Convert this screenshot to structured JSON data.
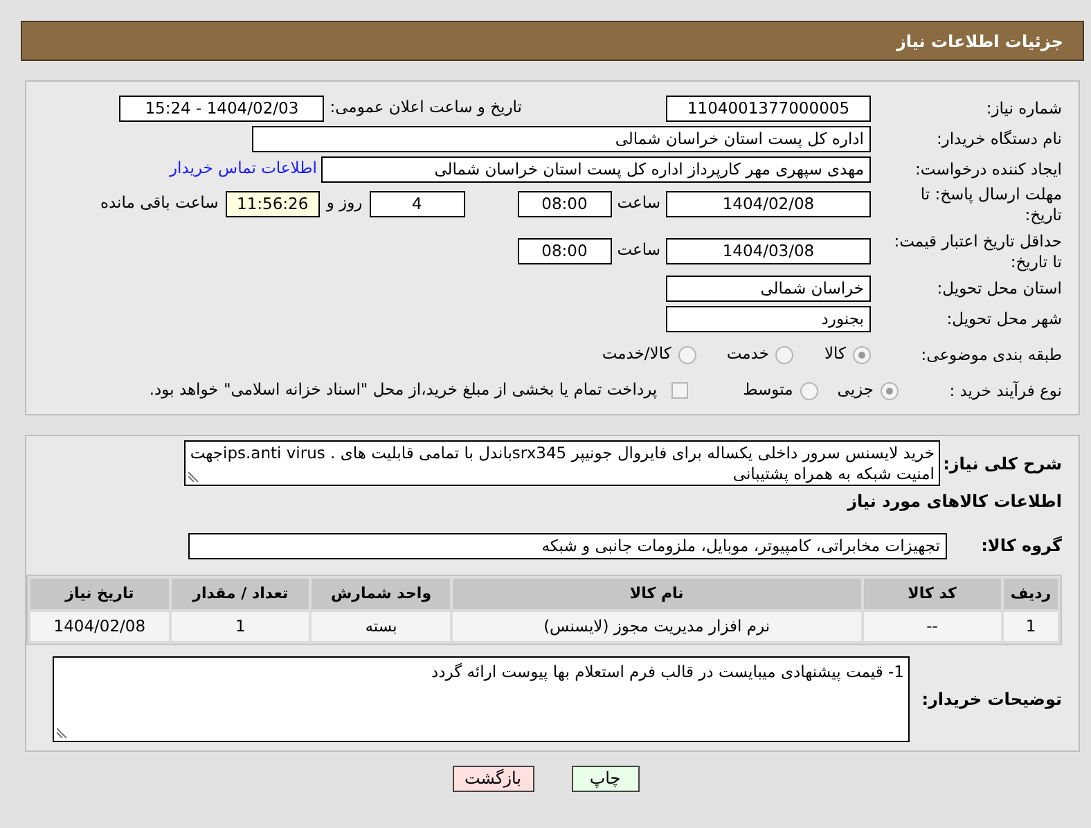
{
  "header": {
    "title": "جزئیات اطلاعات نیاز"
  },
  "need_number": {
    "label": "شماره نیاز:",
    "value": "1104001377000005"
  },
  "announce": {
    "label": "تاریخ و ساعت اعلان عمومی:",
    "value": "1404/02/03 - 15:24"
  },
  "buyer_org": {
    "label": "نام دستگاه خریدار:",
    "value": "اداره کل پست استان خراسان شمالی"
  },
  "requester": {
    "label": "ایجاد کننده درخواست:",
    "value": "مهدی سپهری مهر کارپرداز اداره کل پست استان خراسان شمالی",
    "link": "اطلاعات تماس خریدار"
  },
  "reply_deadline": {
    "label": "مهلت ارسال پاسخ: تا تاریخ:",
    "date": "1404/02/08",
    "time_label": "ساعت",
    "time": "08:00",
    "days": "4",
    "days_label": "روز و",
    "remaining": "11:56:26",
    "remaining_label": "ساعت باقی مانده"
  },
  "price_validity": {
    "label": "حداقل تاریخ اعتبار قیمت: تا تاریخ:",
    "date": "1404/03/08",
    "time_label": "ساعت",
    "time": "08:00"
  },
  "province": {
    "label": "استان محل تحویل:",
    "value": "خراسان شمالی"
  },
  "city": {
    "label": "شهر محل تحویل:",
    "value": "بجنورد"
  },
  "category": {
    "label": "طبقه بندی موضوعی:",
    "disabled": true,
    "options": [
      {
        "label": "کالا",
        "selected": true
      },
      {
        "label": "خدمت",
        "selected": false
      },
      {
        "label": "کالا/خدمت",
        "selected": false
      }
    ]
  },
  "process": {
    "label": "نوع فرآیند خرید :",
    "disabled": true,
    "options": [
      {
        "label": "جزیی",
        "selected": true
      },
      {
        "label": "متوسط",
        "selected": false
      }
    ],
    "payment": {
      "checked": false,
      "text": "پرداخت تمام یا بخشی از مبلغ خرید،از محل \"اسناد خزانه اسلامی\" خواهد بود."
    }
  },
  "description": {
    "label": "شرح کلی نیاز:",
    "text": "خرید لایسنس سرور داخلی یکساله برای فایروال جونیپر srx345باندل با تمامی قابلیت های . ips.anti virusجهت امنیت شبکه به همراه پشتیبانی"
  },
  "goods_heading": "اطلاعات کالاهای مورد نیاز",
  "goods_group": {
    "label": "گروه کالا:",
    "value": "تجهیزات مخابراتی، کامپیوتر، موبایل، ملزومات جانبی و شبکه"
  },
  "table": {
    "columns": [
      "ردیف",
      "کد کالا",
      "نام کالا",
      "واحد شمارش",
      "تعداد / مقدار",
      "تاریخ نیاز"
    ],
    "rows": [
      [
        "1",
        "--",
        "نرم افزار مدیریت مجوز (لایسنس)",
        "بسته",
        "1",
        "1404/02/08"
      ]
    ]
  },
  "buyer_notes": {
    "label": "توضیحات خریدار:",
    "text": "1- قیمت پیشنهادی میبایست در قالب فرم استعلام بها پیوست ارائه گردد"
  },
  "buttons": [
    {
      "label": "چاپ",
      "kind": "print"
    },
    {
      "label": "بازگشت",
      "kind": "back"
    }
  ]
}
